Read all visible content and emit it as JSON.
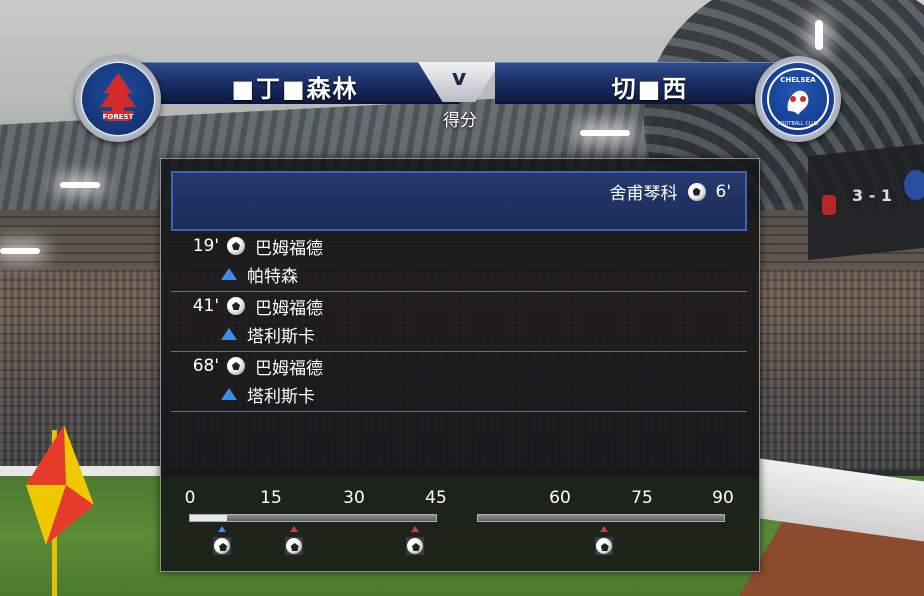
{
  "header": {
    "home_team": "■丁■森林",
    "versus": "v",
    "away_team": "切■西",
    "subtitle": "得分",
    "home_crest_icon": "nottingham-forest-crest-icon",
    "away_crest_icon": "chelsea-crest-icon"
  },
  "background": {
    "scoreboard_score": "3 - 1"
  },
  "away_goals": [
    {
      "scorer": "舍甫琴科",
      "minute": "6'"
    }
  ],
  "home_goals": [
    {
      "minute": "19'",
      "scorer": "巴姆福德",
      "assist": "帕特森"
    },
    {
      "minute": "41'",
      "scorer": "巴姆福德",
      "assist": "塔利斯卡"
    },
    {
      "minute": "68'",
      "scorer": "巴姆福德",
      "assist": "塔利斯卡"
    }
  ],
  "timeline": {
    "first_half_ticks": [
      "0",
      "15",
      "30",
      "45"
    ],
    "second_half_ticks": [
      "60",
      "75",
      "90"
    ],
    "elapsed_fraction_first_half": 0.15,
    "events": [
      {
        "minute": 6,
        "team": "away"
      },
      {
        "minute": 19,
        "team": "home"
      },
      {
        "minute": 41,
        "team": "home"
      },
      {
        "minute": 68,
        "team": "home"
      }
    ]
  },
  "colors": {
    "home_marker": "#c94040",
    "away_marker": "#3d8ee8",
    "panel_highlight": "#253a6e"
  }
}
